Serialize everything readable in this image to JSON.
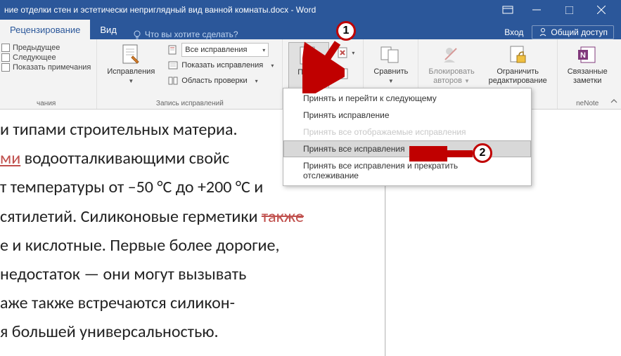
{
  "titlebar": {
    "title": "ние отделки стен и эстетически неприглядный вид ванной комнаты.docx - Word"
  },
  "tabs": {
    "review": "Рецензирование",
    "view": "Вид",
    "tellme": "Что вы хотите сделать?",
    "signin": "Вход",
    "share": "Общий доступ"
  },
  "ribbon": {
    "show": {
      "prev": "Предыдущее",
      "next": "Следующее",
      "show_notes": "Показать примечания",
      "group_label": "чания"
    },
    "tracking": {
      "button": "Исправления",
      "combo": "Все исправления",
      "show_changes": "Показать исправления",
      "review_pane": "Область проверки",
      "group_label": "Запись исправлений"
    },
    "changes": {
      "accept": "Приня",
      "group_label": ""
    },
    "compare": {
      "button": "Сравнить"
    },
    "protect": {
      "block_authors": "Блокировать",
      "block_authors2": "авторов",
      "restrict": "Ограничить",
      "restrict2": "редактирование"
    },
    "onenote": {
      "linked": "Связанные",
      "linked2": "заметки",
      "group_label": "neNote"
    }
  },
  "dropdown": {
    "item1": "Принять и перейти к следующему",
    "item2": "Принять исправление",
    "item3": "Принять все отображаемые исправления",
    "item4": "Принять все исправления",
    "item5": "Принять все исправления и прекратить отслеживание"
  },
  "document": {
    "line1": "и типами строительных материа.",
    "line2_pre": "",
    "line2_red": "ми",
    "line2_post": " водоотталкивающими свойс",
    "line3": "т температуры от –50 °C до +200 °C и",
    "line4_pre": "сятилетий. Силиконовые герметики ",
    "line4_strike": "также",
    "line5": "е и кислотные. Первые более дорогие,",
    "line6": "недостаток — они могут вызывать",
    "line7": "аже также встречаются силикон-",
    "line8": "я большей универсальностью."
  },
  "callouts": {
    "n1": "1",
    "n2": "2"
  }
}
